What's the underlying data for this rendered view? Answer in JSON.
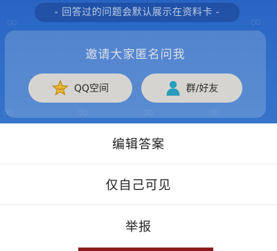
{
  "background": {
    "hint_text": "- 回答过的问题会默认展示在资料卡 -",
    "invite_card": {
      "title": "邀请大家匿名问我",
      "buttons": [
        {
          "label": "QQ空间",
          "icon": "star-icon"
        },
        {
          "label": "群/好友",
          "icon": "person-icon"
        }
      ]
    }
  },
  "action_sheet": {
    "items": [
      {
        "label": "编辑答案"
      },
      {
        "label": "仅自己可见"
      },
      {
        "label": "举报"
      }
    ]
  },
  "colors": {
    "top_background": "#2f6fd0",
    "button_background": "#e4e2df",
    "sheet_background": "#ffffff",
    "bottom_accent": "#8c1b1b"
  }
}
